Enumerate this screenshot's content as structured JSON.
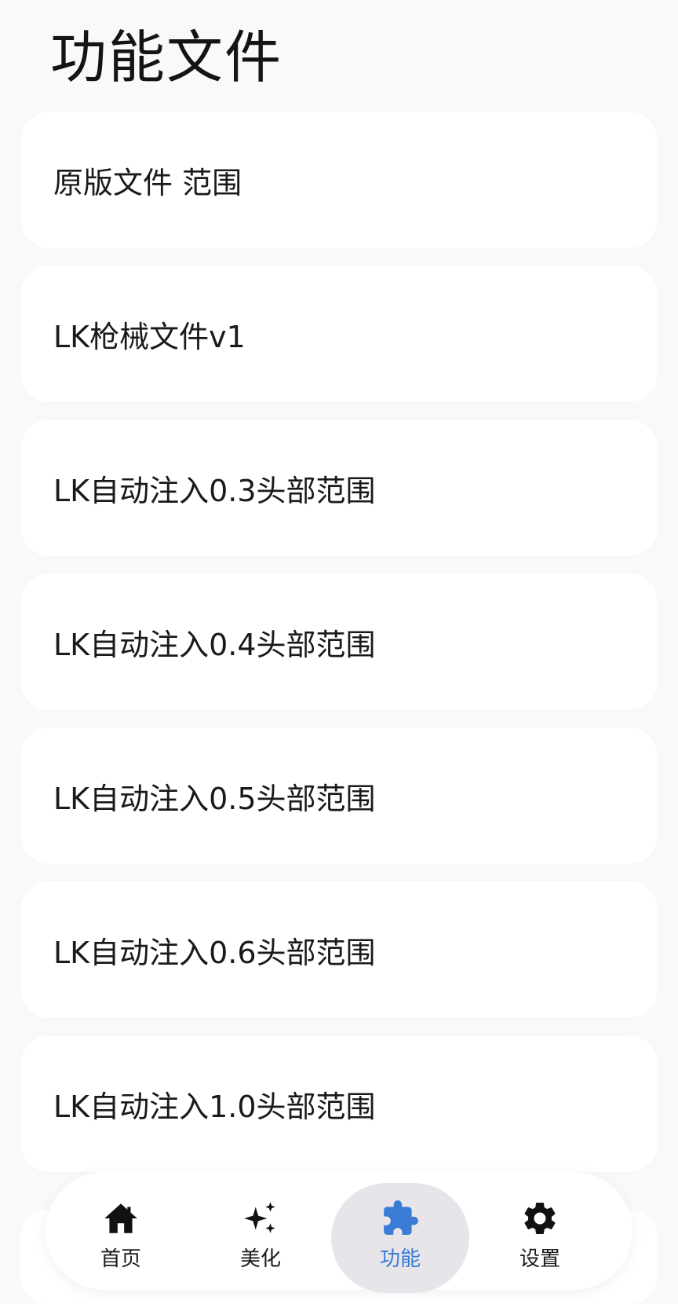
{
  "page": {
    "title": "功能文件"
  },
  "items": [
    {
      "label": "原版文件 范围"
    },
    {
      "label": "LK枪械文件v1"
    },
    {
      "label": "LK自动注入0.3头部范围"
    },
    {
      "label": "LK自动注入0.4头部范围"
    },
    {
      "label": "LK自动注入0.5头部范围"
    },
    {
      "label": "LK自动注入0.6头部范围"
    },
    {
      "label": "LK自动注入1.0头部范围"
    }
  ],
  "nav": {
    "items": [
      {
        "label": "首页",
        "icon": "home-icon"
      },
      {
        "label": "美化",
        "icon": "sparkles-icon"
      },
      {
        "label": "功能",
        "icon": "puzzle-icon",
        "active": true
      },
      {
        "label": "设置",
        "icon": "gear-icon"
      }
    ]
  },
  "colors": {
    "background": "#fbf8fb",
    "card": "#ffffff",
    "accent": "#3a7bd5",
    "active_pill": "#e7e5ea"
  }
}
